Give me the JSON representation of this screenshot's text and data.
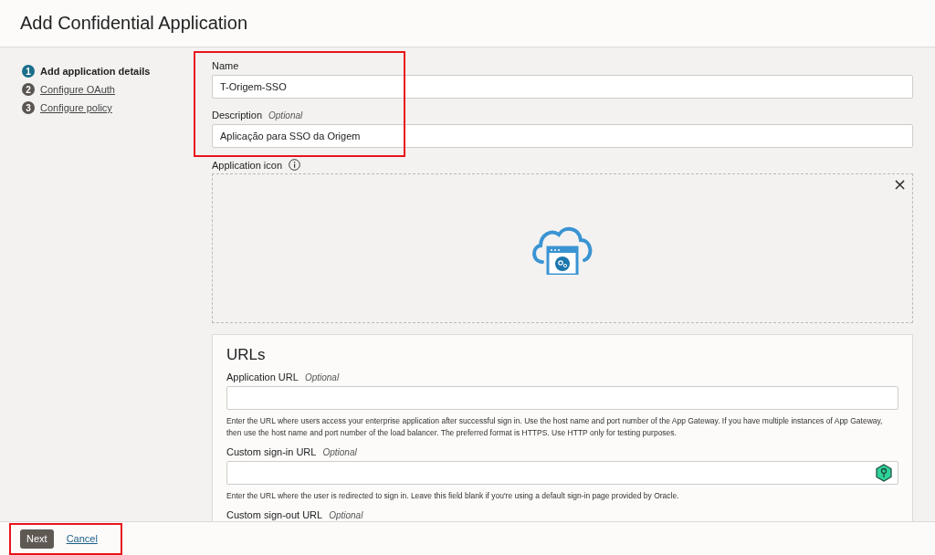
{
  "page": {
    "title": "Add Confidential Application"
  },
  "steps": [
    {
      "number": "1",
      "label": "Add application details",
      "selected": true
    },
    {
      "number": "2",
      "label": "Configure OAuth",
      "selected": false
    },
    {
      "number": "3",
      "label": "Configure policy",
      "selected": false
    }
  ],
  "form": {
    "name": {
      "label": "Name",
      "value": "T-Origem-SSO"
    },
    "description": {
      "label": "Description",
      "hint": "Optional",
      "value": "Aplicação para SSO da Origem"
    },
    "application_icon": {
      "label": "Application icon",
      "close": "×"
    }
  },
  "urls": {
    "title": "URLs",
    "fields": [
      {
        "label": "Application URL",
        "hint": "Optional",
        "kind": "plain",
        "help": "Enter the URL where users access your enterprise application after successful sign in. Use the host name and port number of the App Gateway. If you have multiple instances of App Gateway, then use the host name and port number of the load balancer. The preferred format is HTTPS. Use HTTP only for testing purposes."
      },
      {
        "label": "Custom sign-in URL",
        "hint": "Optional",
        "kind": "key",
        "help": "Enter the URL where the user is redirected to sign in. Leave this field blank if you're using a default sign-in page provided by Oracle."
      },
      {
        "label": "Custom sign-out URL",
        "hint": "Optional",
        "kind": "label-only"
      }
    ]
  },
  "footer": {
    "buttons": [
      {
        "label": "Next",
        "kind": "primary"
      },
      {
        "label": "Cancel",
        "kind": "link"
      }
    ]
  },
  "annotations": {
    "form_highlighted": true,
    "footer_highlighted": true
  }
}
